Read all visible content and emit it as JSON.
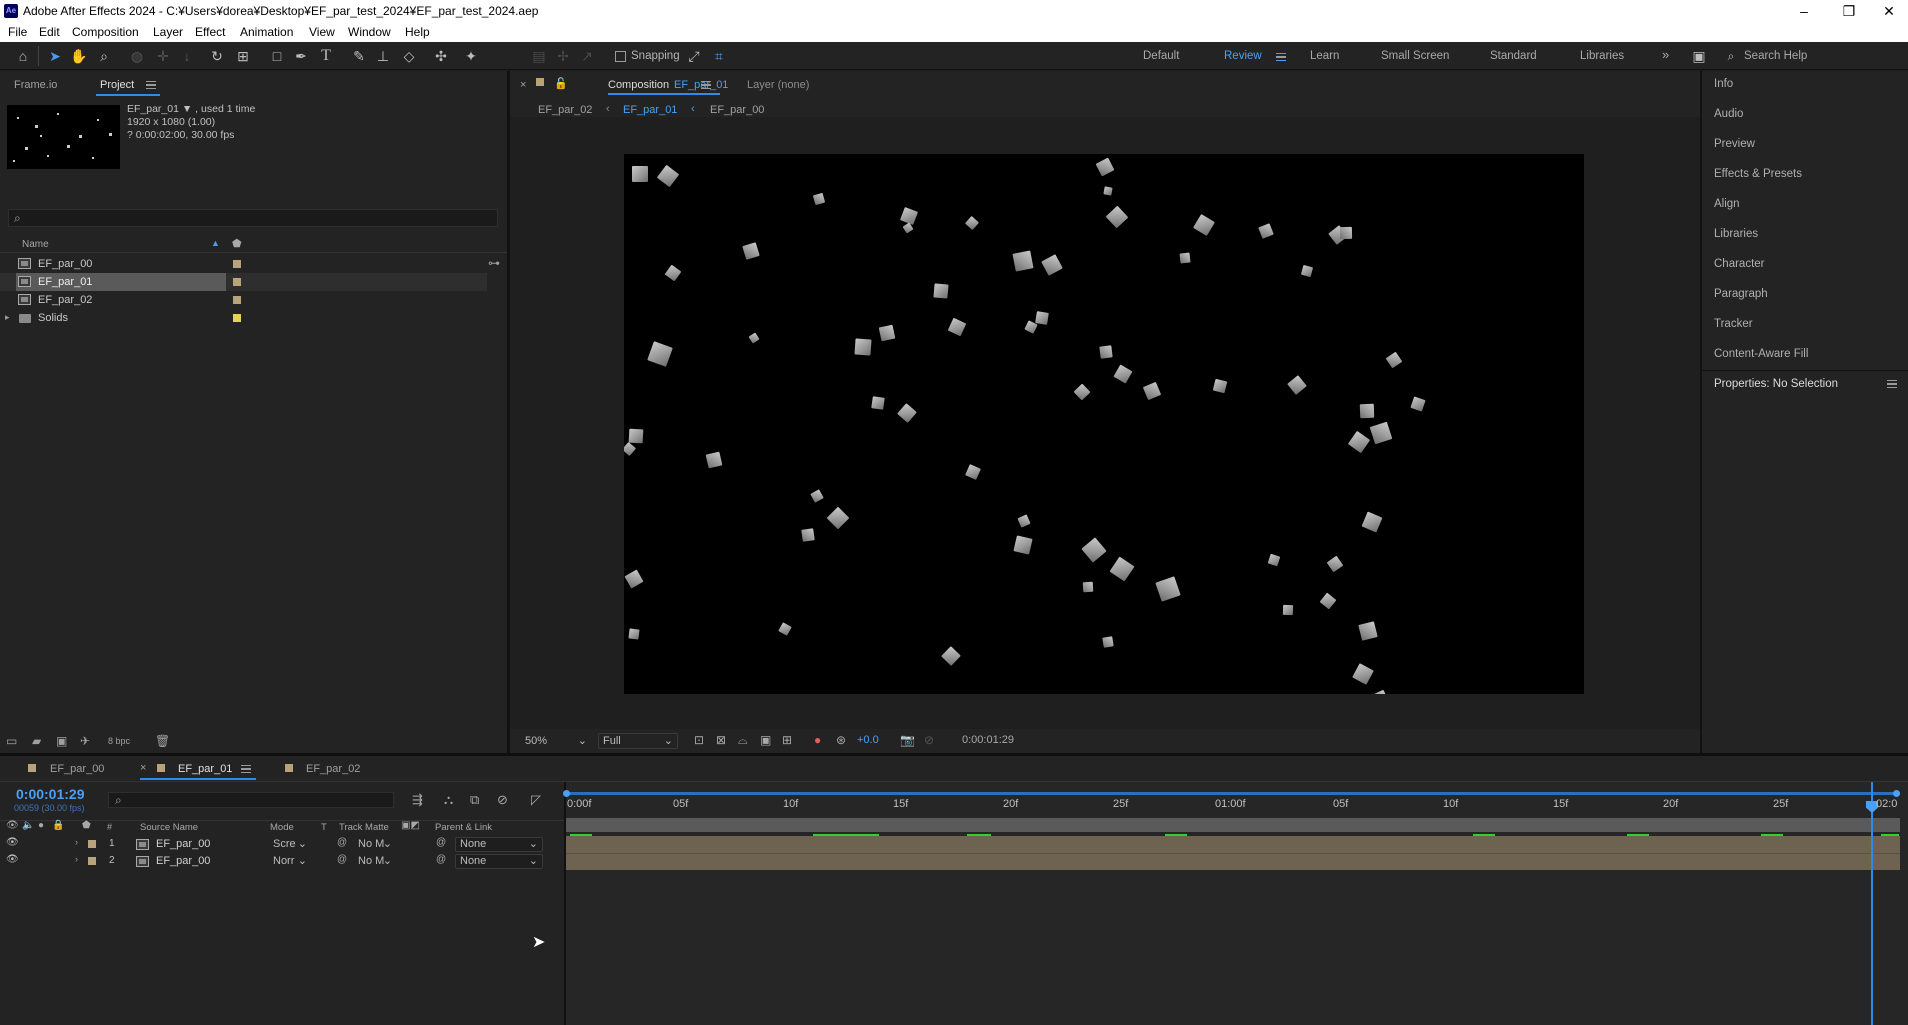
{
  "window": {
    "title": "Adobe After Effects 2024 - C:¥Users¥dorea¥Desktop¥EF_par_test_2024¥EF_par_test_2024.aep",
    "logo": "Ae"
  },
  "menu": [
    "File",
    "Edit",
    "Composition",
    "Layer",
    "Effect",
    "Animation",
    "View",
    "Window",
    "Help"
  ],
  "toolbar": {
    "snapping_label": "Snapping",
    "workspaces": [
      "Default",
      "Review",
      "Learn",
      "Small Screen",
      "Standard",
      "Libraries"
    ],
    "active_workspace": "Review",
    "search_placeholder": "Search Help",
    "accent": "#2d8ceb"
  },
  "project": {
    "tabs": [
      "Frame.io",
      "Project"
    ],
    "active_tab": "Project",
    "preview": {
      "name": "EF_par_01 ▼ , used 1 time",
      "size": "1920 x 1080 (1.00)",
      "duration": "? 0:00:02:00, 30.00 fps"
    },
    "search_placeholder": "",
    "col_name": "Name",
    "items": [
      {
        "name": "EF_par_00",
        "type": "comp",
        "color": "#b9a37a"
      },
      {
        "name": "EF_par_01",
        "type": "comp",
        "color": "#b9a37a",
        "selected": true
      },
      {
        "name": "EF_par_02",
        "type": "comp",
        "color": "#b9a37a"
      },
      {
        "name": "Solids",
        "type": "folder",
        "color": "#e3d35a"
      }
    ],
    "bpc": "8 bpc"
  },
  "composition": {
    "tab_prefix": "Composition",
    "tab_name": "EF_par_01",
    "layer_tab": "Layer (none)",
    "breadcrumbs": [
      "EF_par_02",
      "EF_par_01",
      "EF_par_00"
    ],
    "active_crumb": "EF_par_01",
    "zoom": "50%",
    "resolution": "Full",
    "exposure": "+0.0",
    "timecode": "0:00:01:29"
  },
  "right_panels": [
    "Info",
    "Audio",
    "Preview",
    "Effects & Presets",
    "Align",
    "Libraries",
    "Character",
    "Paragraph",
    "Tracker",
    "Content-Aware Fill"
  ],
  "properties_title": "Properties: No Selection",
  "timeline": {
    "tabs": [
      "EF_par_00",
      "EF_par_01",
      "EF_par_02"
    ],
    "active_tab": "EF_par_01",
    "timecode": "0:00:01:29",
    "frames": "00059 (30.00 fps)",
    "headers": {
      "num": "#",
      "source": "Source Name",
      "mode": "Mode",
      "t": "T",
      "track_matte": "Track Matte",
      "parent": "Parent & Link"
    },
    "layers": [
      {
        "num": "1",
        "name": "EF_par_00",
        "mode": "Scre",
        "matte": "No M",
        "parent": "None"
      },
      {
        "num": "2",
        "name": "EF_par_00",
        "mode": "Norr",
        "matte": "No M",
        "parent": "None"
      }
    ],
    "ruler": [
      "0:00f",
      "05f",
      "10f",
      "15f",
      "20f",
      "25f",
      "01:00f",
      "05f",
      "10f",
      "15f",
      "20f",
      "25f",
      "02:0"
    ],
    "playhead_value": "0:00:01:29"
  }
}
